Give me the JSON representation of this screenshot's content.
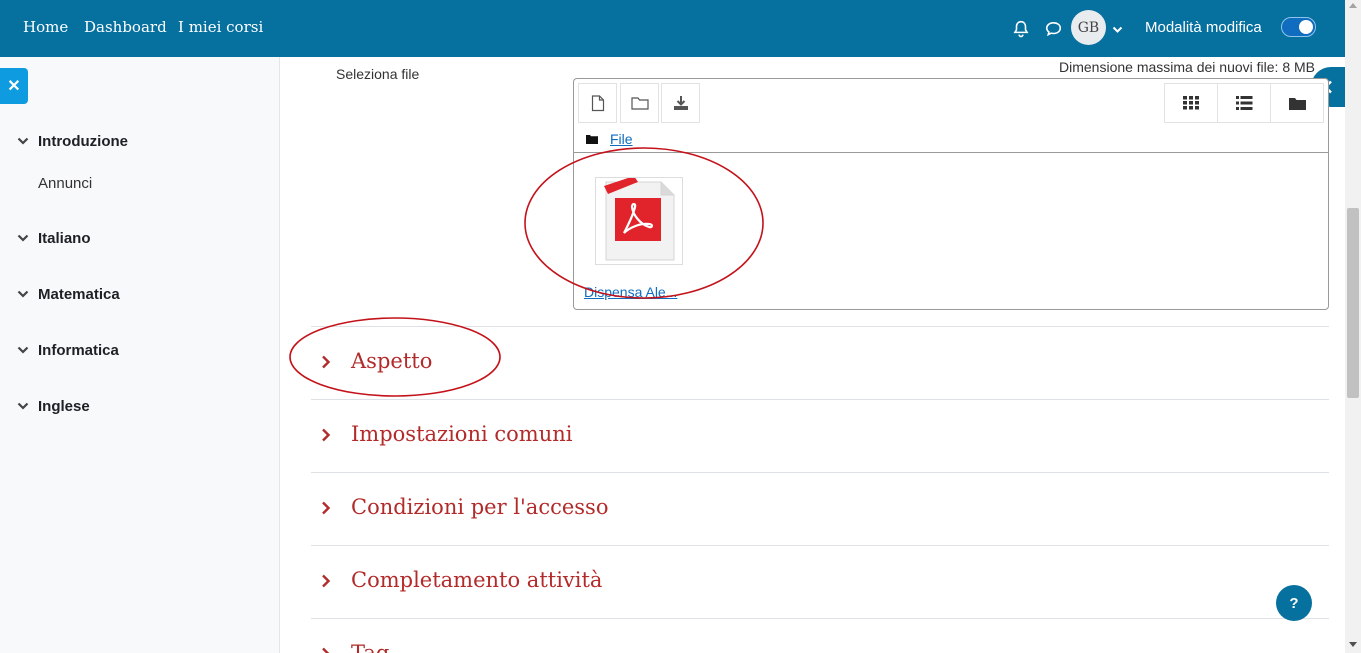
{
  "navbar": {
    "links": [
      "Home",
      "Dashboard",
      "I miei corsi"
    ],
    "avatar_initials": "GB",
    "edit_mode_label": "Modalità modifica",
    "edit_mode_on": true
  },
  "drawer": {
    "items": [
      {
        "label": "Introduzione",
        "expanded": true,
        "children": [
          "Annunci"
        ]
      },
      {
        "label": "Italiano",
        "expanded": true,
        "children": []
      },
      {
        "label": "Matematica",
        "expanded": true,
        "children": []
      },
      {
        "label": "Informatica",
        "expanded": true,
        "children": []
      },
      {
        "label": "Inglese",
        "expanded": true,
        "children": []
      }
    ]
  },
  "filepicker": {
    "label": "Seleziona file",
    "max_size_text": "Dimensione massima dei nuovi file: 8 MB",
    "path_label": "File",
    "files": [
      {
        "name": "Dispensa Ale...",
        "type": "pdf-icon"
      }
    ]
  },
  "sections": [
    {
      "title": "Aspetto"
    },
    {
      "title": "Impostazioni comuni"
    },
    {
      "title": "Condizioni per l'accesso"
    },
    {
      "title": "Completamento attività"
    },
    {
      "title": "Tag"
    }
  ],
  "help_button": "?",
  "colors": {
    "navbar": "#06709f",
    "section_title": "#b32a2a",
    "link": "#0f6cbf",
    "annotation": "#c4121a"
  }
}
